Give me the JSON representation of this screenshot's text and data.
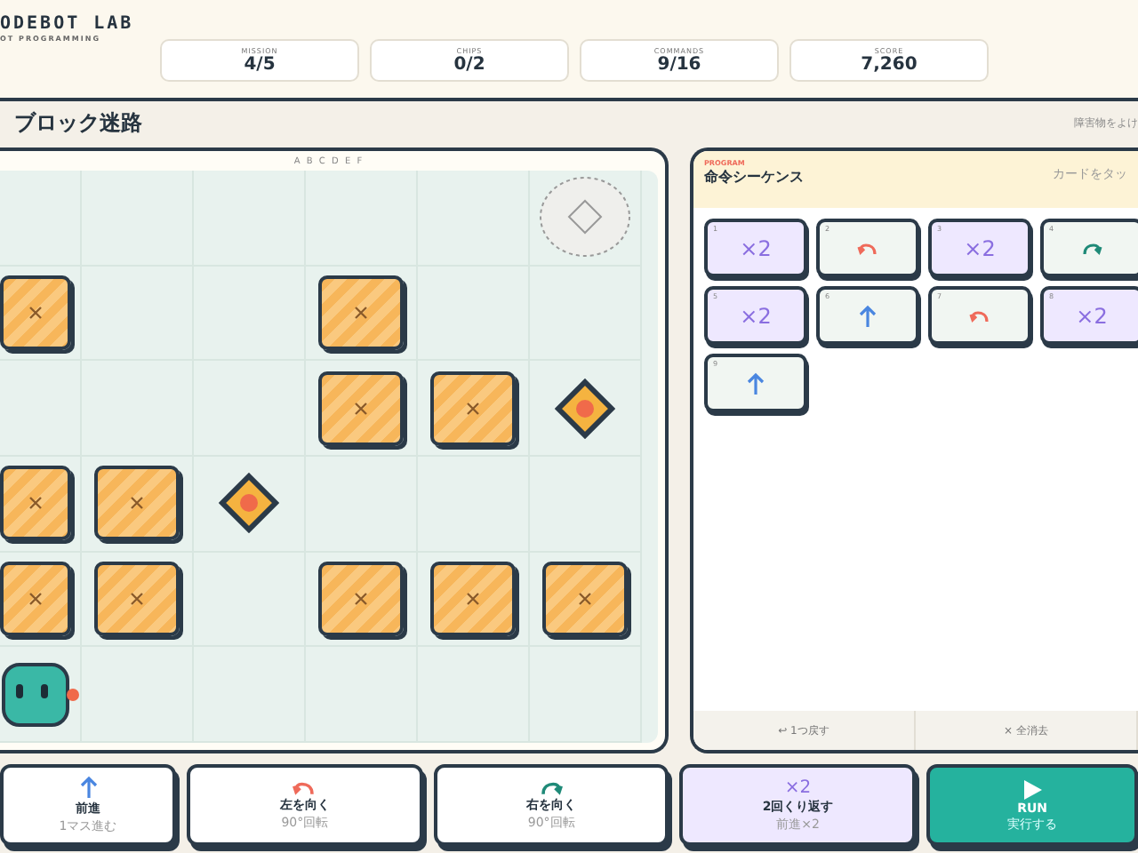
{
  "brand": {
    "title": "ODEBOT LAB",
    "subtitle": "OT PROGRAMMING"
  },
  "stats": [
    {
      "label": "MISSION",
      "value": "4/5"
    },
    {
      "label": "CHIPS",
      "value": "0/2"
    },
    {
      "label": "COMMANDS",
      "value": "9/16"
    },
    {
      "label": "SCORE",
      "value": "7,260"
    }
  ],
  "stage": {
    "title": "ブロック迷路",
    "hint": "障害物をよけ"
  },
  "board": {
    "columns": "A B C D E F",
    "rows": [
      [
        {
          "kind": "empty"
        },
        {
          "kind": "empty"
        },
        {
          "kind": "empty"
        },
        {
          "kind": "empty"
        },
        {
          "kind": "empty"
        },
        {
          "kind": "goal"
        }
      ],
      [
        {
          "kind": "block"
        },
        {
          "kind": "empty"
        },
        {
          "kind": "empty"
        },
        {
          "kind": "block"
        },
        {
          "kind": "empty"
        },
        {
          "kind": "empty"
        }
      ],
      [
        {
          "kind": "empty"
        },
        {
          "kind": "empty"
        },
        {
          "kind": "empty"
        },
        {
          "kind": "block"
        },
        {
          "kind": "block"
        },
        {
          "kind": "chip"
        }
      ],
      [
        {
          "kind": "block"
        },
        {
          "kind": "block"
        },
        {
          "kind": "chip"
        },
        {
          "kind": "empty"
        },
        {
          "kind": "empty"
        },
        {
          "kind": "empty"
        }
      ],
      [
        {
          "kind": "block"
        },
        {
          "kind": "block"
        },
        {
          "kind": "empty"
        },
        {
          "kind": "block"
        },
        {
          "kind": "block"
        },
        {
          "kind": "block"
        }
      ],
      [
        {
          "kind": "robot"
        },
        {
          "kind": "empty"
        },
        {
          "kind": "empty"
        },
        {
          "kind": "empty"
        },
        {
          "kind": "empty"
        },
        {
          "kind": "empty"
        }
      ]
    ]
  },
  "program": {
    "eyebrow": "PROGRAM",
    "title": "命令シーケンス",
    "hint": "カードをタッ",
    "cards": [
      {
        "num": "1",
        "kind": "repeat",
        "label": "×2"
      },
      {
        "num": "2",
        "kind": "left"
      },
      {
        "num": "3",
        "kind": "repeat",
        "label": "×2"
      },
      {
        "num": "4",
        "kind": "right"
      },
      {
        "num": "5",
        "kind": "repeat",
        "label": "×2"
      },
      {
        "num": "6",
        "kind": "forward"
      },
      {
        "num": "7",
        "kind": "left"
      },
      {
        "num": "8",
        "kind": "repeat",
        "label": "×2"
      },
      {
        "num": "9",
        "kind": "forward"
      }
    ],
    "actions": [
      "↩ 1つ戻す",
      "× 全消去"
    ]
  },
  "palette": [
    {
      "kind": "forward",
      "title": "前進",
      "sub": "1マス進む"
    },
    {
      "kind": "left",
      "title": "左を向く",
      "sub": "90°回転"
    },
    {
      "kind": "right",
      "title": "右を向く",
      "sub": "90°回転"
    },
    {
      "kind": "repeat",
      "label": "×2",
      "title": "2回くり返す",
      "sub": "前進×2"
    },
    {
      "kind": "run",
      "title": "RUN",
      "sub": "実行する"
    }
  ]
}
